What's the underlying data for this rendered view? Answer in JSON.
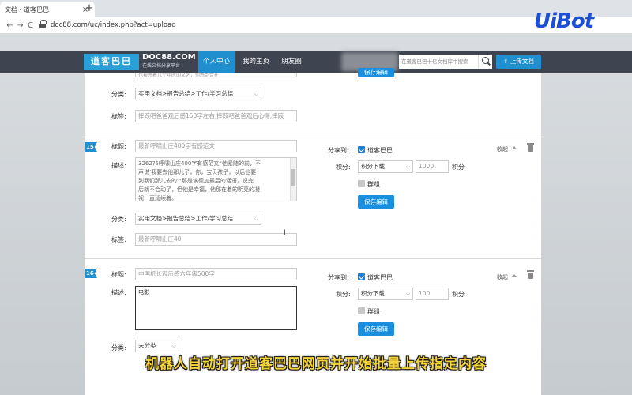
{
  "browser": {
    "tab_title": "文档 - 道客巴巴",
    "tab_close": "×",
    "new_tab": "+",
    "back": "←",
    "forward": "→",
    "reload": "C",
    "url": "doc88.com/uc/index.php?act=upload"
  },
  "watermark": {
    "text": "UiBot"
  },
  "header": {
    "logo_cn": "道客巴巴",
    "logo_en": "DOC88.COM",
    "logo_sub": "在线文档分享平台",
    "nav": [
      "个人中心",
      "我的主页",
      "朋友圈"
    ],
    "search_placeholder": "在道客巴巴十亿文档库中搜索",
    "upload_label": "上传文档"
  },
  "top_fragment": {
    "desc_tail": "也被感着几个年时的文艺，你感到合在",
    "save_label": "保存编辑",
    "category_label": "分类:",
    "category_value": "实用文档>报告总结>工作/学习总结",
    "tags_label": "标签:",
    "tags_value": "摔跤吧爸爸观后感150字左右,摔跤吧爸爸观后心得,摔跤"
  },
  "item15": {
    "number": "15",
    "title_label": "标题:",
    "title_value": "最新呼啸山庄400字有感范文",
    "desc_label": "描述:",
    "desc_lines": [
      "3262?5呼啸山庄400字有感范文“他紧随的前，不",
      "声说‘我要去他那儿了，你，宝贝孩子，以后也要",
      "到我们那儿去的’”那是埃德加最后的话语，说完",
      "后就不会动了，但他是幸福，他那在着的明亮的凝",
      "视一直延续着。"
    ],
    "category_label": "分类:",
    "category_value": "实用文档>报告总结>工作/学习总结",
    "tags_label": "标签:",
    "tags_value": "最新呼啸山庄40",
    "share_label": "分享到:",
    "share_target": "道客巴巴",
    "points_label": "积分:",
    "points_mode": "积分下载",
    "points_value": "1000",
    "points_unit": "积分",
    "group_label": "群组",
    "save_label": "保存编辑",
    "collapse_label": "收起"
  },
  "item16": {
    "number": "16",
    "title_label": "标题:",
    "title_value": "中国机长观后感六年级500字",
    "desc_label": "描述:",
    "desc_value": "电影",
    "category_label": "分类:",
    "category_value": "未分类",
    "share_label": "分享到:",
    "share_target": "道客巴巴",
    "points_label": "积分:",
    "points_mode": "积分下载",
    "points_value": "100",
    "points_unit": "积分",
    "group_label": "群组",
    "save_label": "保存编辑",
    "collapse_label": "收起"
  },
  "subtitle": "机器人自动打开道客巴巴网页并开始批量上传指定内容"
}
